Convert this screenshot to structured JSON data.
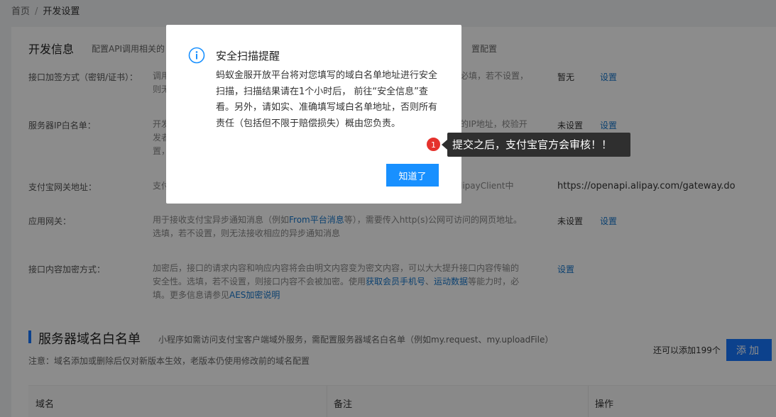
{
  "breadcrumb": {
    "home": "首页",
    "separator": "/",
    "current": "开发设置"
  },
  "dev_info": {
    "title": "开发信息",
    "desc": "配置API调用相关的",
    "desc_right": "置配置"
  },
  "rows": [
    {
      "label": "接口加签方式（密钥/证书）：",
      "desc": "调用\n则无",
      "desc_right": "必填，若不设置，",
      "value": "暂无",
      "link": "设置"
    },
    {
      "label": "服务器IP白名单：",
      "desc": "开发\n发者\n置，",
      "desc_right": "的IP地址，校验开\n，选填，若不设",
      "value": "未设置",
      "link": "设置"
    },
    {
      "label": "支付宝网关地址：",
      "desc": "支付",
      "desc_right": "lipayClient中",
      "value": "https://openapi.alipay.com/gateway.do",
      "link": ""
    },
    {
      "label": "应用网关：",
      "desc_a": "用于接收支付宝异步通知消息（例如",
      "desc_link": "From平台消息",
      "desc_b": "等），需要传入http(s)公网可访问的网页地址。",
      "desc_c": "选填，若不设置，则无法接收相应的异步通知消息",
      "value": "未设置",
      "link": "设置"
    },
    {
      "label": "接口内容加密方式：",
      "desc_a": "加密后，接口的请求内容和响应内容将会由明文内容变为密文内容，可以大大提升接口内容传输的",
      "desc_b": "安全性。选填，若不设置，则接口内容不会被加密。使用",
      "desc_link1": "获取会员手机号",
      "desc_sep": "、",
      "desc_link2": "运动数据",
      "desc_c": "等能力时，必",
      "desc_d": "填。更多信息请参见",
      "desc_link3": "AES加密说明",
      "link": "设置"
    }
  ],
  "domain_section": {
    "title": "服务器域名白名单",
    "desc": "小程序如需访问支付宝客户端域外服务，需配置服务器域名白名单（例如my.request、my.uploadFile）",
    "note": "注意：域名添加或删除后仅对新版本生效，老版本仍使用修改前的域名配置",
    "quota": "还可以添加199个",
    "add_label": "添加",
    "columns": [
      "域名",
      "备注",
      "操作"
    ]
  },
  "modal": {
    "title": "安全扫描提醒",
    "body": "蚂蚁金服开放平台将对您填写的域白名单地址进行安全扫描，扫描结果请在1个小时后， 前往“安全信息”查看。另外，请如实、准确填写域白名单地址，否则所有责任（包括但不限于赔偿损失）概由您负责。",
    "ok_label": "知道了"
  },
  "tooltip": {
    "badge": "1",
    "text": "提交之后，支付宝官方会审核！！"
  },
  "colors": {
    "primary": "#1677ff",
    "link": "#1677cc",
    "badge": "#e5322d",
    "tooltip_bg": "#2f2f2f"
  }
}
